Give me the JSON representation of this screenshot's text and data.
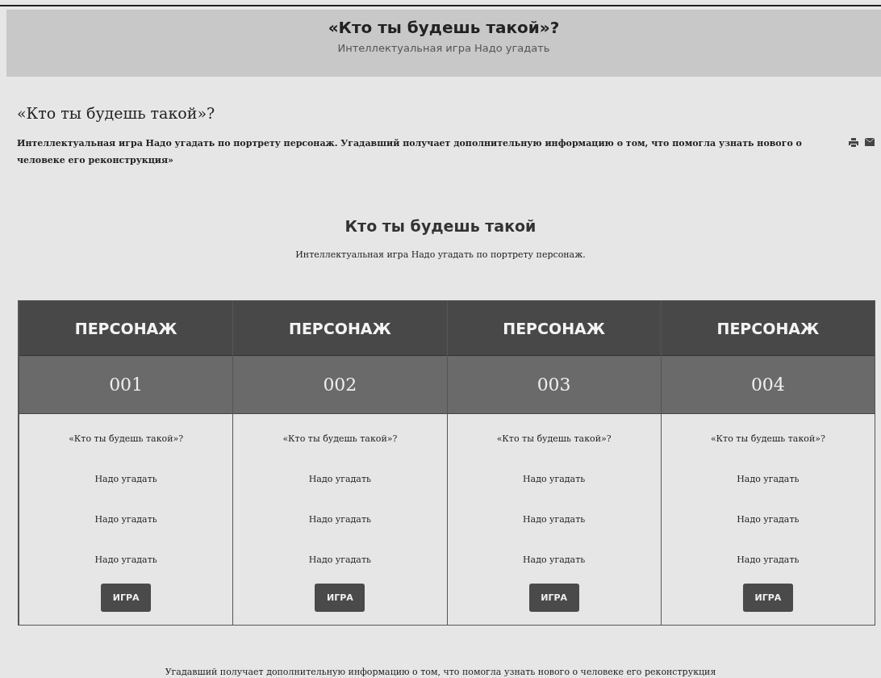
{
  "header": {
    "title": "«Кто ты будешь такой»?",
    "subtitle": "Интеллектуальная игра Надо угадать"
  },
  "article": {
    "title": "«Кто ты будешь такой»?",
    "intro": "Интеллектуальная игра Надо угадать по портрету персонаж. Угадавший получает дополнительную информацию о том, что помогла узнать нового о человеке его реконструкция»"
  },
  "section": {
    "title": "Кто ты будешь такой",
    "subtitle": "Интеллектуальная игра Надо угадать по портрету персонаж."
  },
  "cards": [
    {
      "heading": "ПЕРСОНАЖ",
      "number": "001",
      "lines": [
        "«Кто ты будешь такой»?",
        "Надо угадать",
        "Надо угадать",
        "Надо угадать"
      ],
      "button": "ИГРА"
    },
    {
      "heading": "ПЕРСОНАЖ",
      "number": "002",
      "lines": [
        "«Кто ты будешь такой»?",
        "Надо угадать",
        "Надо угадать",
        "Надо угадать"
      ],
      "button": "ИГРА"
    },
    {
      "heading": "ПЕРСОНАЖ",
      "number": "003",
      "lines": [
        "«Кто ты будешь такой»?",
        "Надо угадать",
        "Надо угадать",
        "Надо угадать"
      ],
      "button": "ИГРА"
    },
    {
      "heading": "ПЕРСОНАЖ",
      "number": "004",
      "lines": [
        "«Кто ты будешь такой»?",
        "Надо угадать",
        "Надо угадать",
        "Надо угадать"
      ],
      "button": "ИГРА"
    }
  ],
  "footer_text": "Угадавший получает дополнительную информацию о том, что помогла узнать нового о человеке его реконструкция"
}
